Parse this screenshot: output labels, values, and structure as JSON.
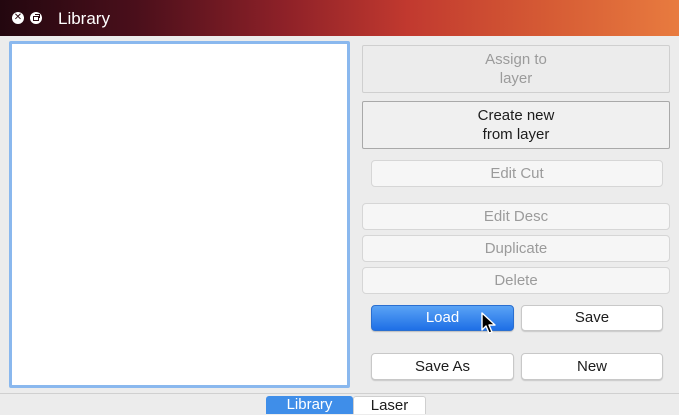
{
  "window": {
    "title": "Library"
  },
  "titlebar": {
    "close_icon": "close-icon",
    "restore_icon": "restore-icon"
  },
  "buttons": {
    "assign_line1": "Assign to",
    "assign_line2": "layer",
    "create_line1": "Create new",
    "create_line2": "from layer",
    "edit_cut": "Edit Cut",
    "edit_desc": "Edit Desc",
    "duplicate": "Duplicate",
    "delete": "Delete",
    "load": "Load",
    "save": "Save",
    "save_as": "Save As",
    "new": "New"
  },
  "tabs": [
    {
      "label": "Library",
      "selected": true
    },
    {
      "label": "Laser",
      "selected": false
    }
  ],
  "colors": {
    "accent_blue": "#3f8ee9",
    "listbox_border": "#8ab8ee"
  }
}
